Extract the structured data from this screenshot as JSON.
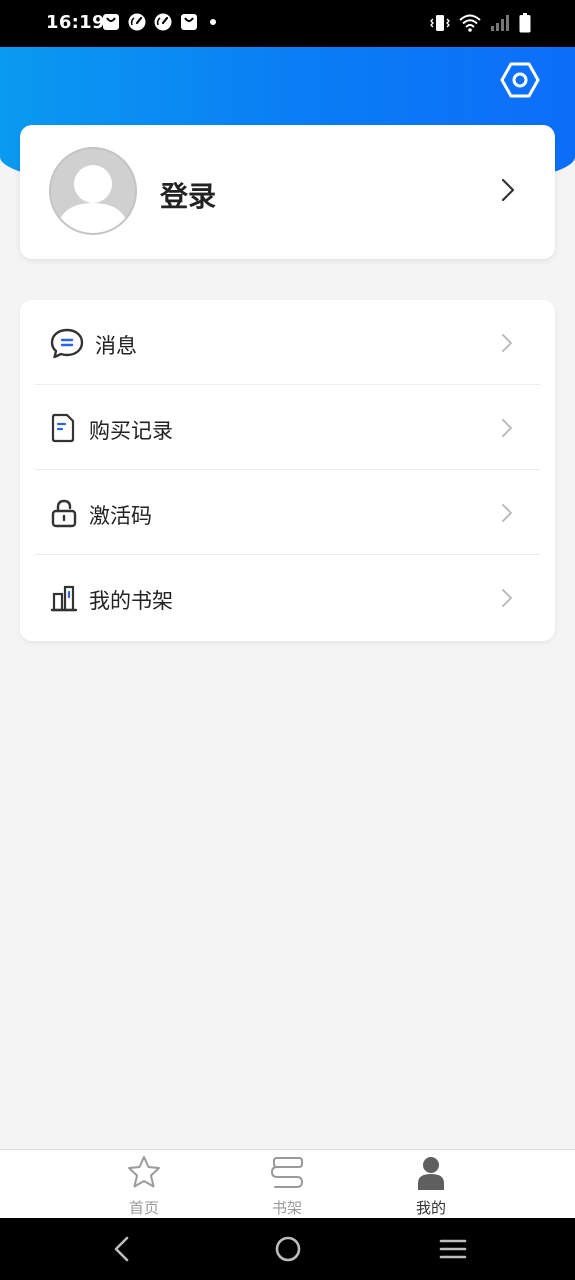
{
  "status_bar": {
    "time": "16:19",
    "left_icons": [
      "shopping-bag-icon",
      "speedometer-icon",
      "speedometer-icon",
      "shopping-bag-icon",
      "dot-icon"
    ],
    "right_icons": [
      "vibrate-icon",
      "wifi-icon",
      "signal-icon",
      "battery-icon"
    ]
  },
  "header": {
    "gradient_colors": [
      "#0a9af0",
      "#0c6ef8"
    ],
    "settings_icon": "hexagon-settings-icon"
  },
  "profile": {
    "login_label": "登录",
    "avatar_icon": "default-avatar-icon"
  },
  "menu": {
    "items": [
      {
        "label": "消息",
        "icon": "message-icon"
      },
      {
        "label": "购买记录",
        "icon": "purchase-record-icon"
      },
      {
        "label": "激活码",
        "icon": "lock-icon"
      },
      {
        "label": "我的书架",
        "icon": "bookshelf-icon"
      }
    ]
  },
  "tabs": [
    {
      "label": "首页",
      "icon": "star-icon",
      "active": false
    },
    {
      "label": "书架",
      "icon": "bookshelf-tab-icon",
      "active": false
    },
    {
      "label": "我的",
      "icon": "user-icon",
      "active": true
    }
  ],
  "colors": {
    "accent": "#0a7cf5",
    "background": "#f4f4f4",
    "icon_accent": "#2a64e8"
  }
}
